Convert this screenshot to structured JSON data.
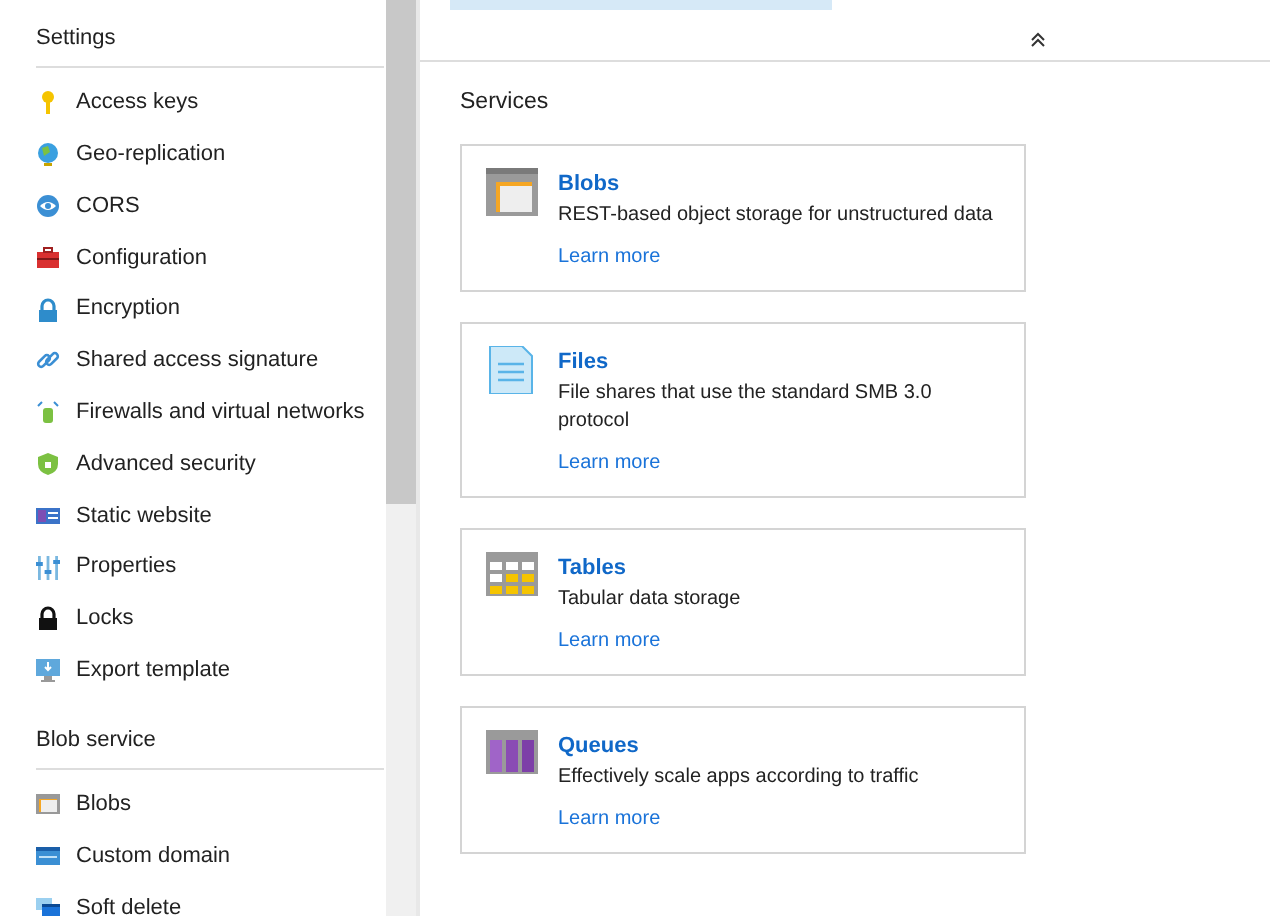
{
  "sidebar": {
    "sections": [
      {
        "title": "Settings",
        "items": [
          {
            "label": "Access keys"
          },
          {
            "label": "Geo-replication"
          },
          {
            "label": "CORS"
          },
          {
            "label": "Configuration"
          },
          {
            "label": "Encryption"
          },
          {
            "label": "Shared access signature"
          },
          {
            "label": "Firewalls and virtual networks"
          },
          {
            "label": "Advanced security"
          },
          {
            "label": "Static website"
          },
          {
            "label": "Properties"
          },
          {
            "label": "Locks"
          },
          {
            "label": "Export template"
          }
        ]
      },
      {
        "title": "Blob service",
        "items": [
          {
            "label": "Blobs"
          },
          {
            "label": "Custom domain"
          },
          {
            "label": "Soft delete"
          }
        ]
      }
    ]
  },
  "main": {
    "section_title": "Services",
    "services": [
      {
        "name": "Blobs",
        "description": "REST-based object storage for unstructured data",
        "link": "Learn more"
      },
      {
        "name": "Files",
        "description": "File shares that use the standard SMB 3.0 protocol",
        "link": "Learn more"
      },
      {
        "name": "Tables",
        "description": "Tabular data storage",
        "link": "Learn more"
      },
      {
        "name": "Queues",
        "description": "Effectively scale apps according to traffic",
        "link": "Learn more"
      }
    ]
  }
}
